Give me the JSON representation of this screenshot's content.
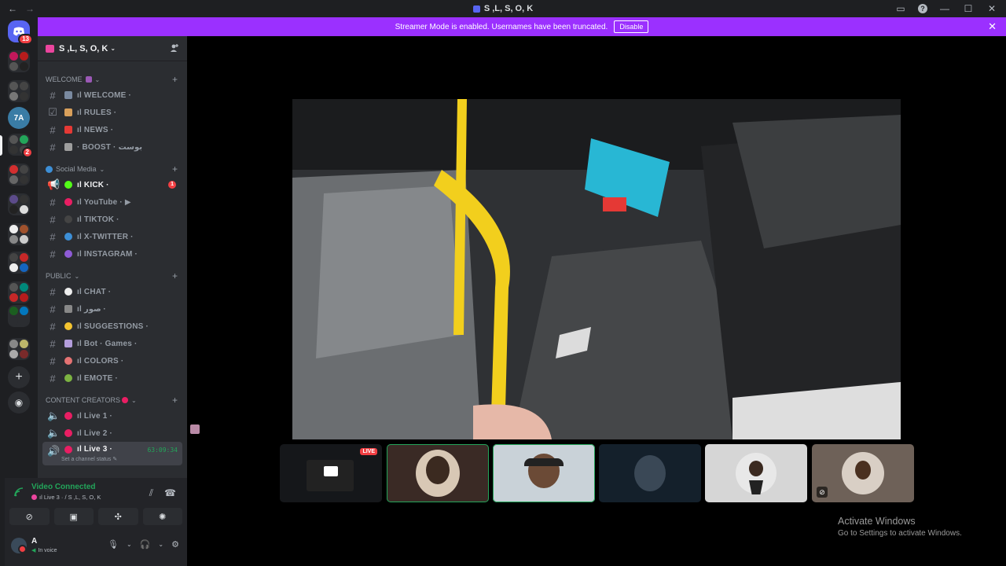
{
  "window": {
    "title": "S ,L, S, O, K"
  },
  "banner": {
    "text": "Streamer Mode is enabled. Usernames have been truncated.",
    "button": "Disable"
  },
  "rail": {
    "dm_badge": "13",
    "server_badge": "2"
  },
  "server": {
    "name": "S ,L, S, O, K"
  },
  "categories": {
    "welcome": "WELCOME",
    "social": "Social Media",
    "public": "PUBLIC",
    "creators": "CONTENT CREATORS"
  },
  "channels": {
    "welcome": "ıl WELCOME ·",
    "rules": "ıl RULES ·",
    "news": "ıl NEWS ·",
    "boost": "· BOOST · بوست",
    "kick": "ıl KICK ·",
    "kick_unread": "1",
    "youtube": "ıl YouTube · ▶",
    "tiktok": "ıl TIKTOK ·",
    "twitter": "ıl X-TWITTER ·",
    "instagram": "ıl INSTAGRAM ·",
    "chat": "ıl CHAT ·",
    "pics": "ıl صور ·",
    "suggestions": "ıl SUGGESTIONS ·",
    "bot": "ıl Bot · Games ·",
    "colors": "ıl COLORS ·",
    "emote": "ıl EMOTE ·",
    "live1": "ıl Live 1 ·",
    "live2": "ıl Live 2 ·",
    "live3": "ıl Live 3 ·",
    "live3_timer": "63:09:34",
    "live3_status": "Set a channel status ✎"
  },
  "voice": {
    "title": "Video Connected",
    "subtitle": "ıl Live 3 · / S ,L, S, O, K"
  },
  "user": {
    "name": "A",
    "status": "In voice"
  },
  "tiles": {
    "live_badge": "LIVE"
  },
  "watermark": {
    "line1": "Activate Windows",
    "line2": "Go to Settings to activate Windows."
  }
}
